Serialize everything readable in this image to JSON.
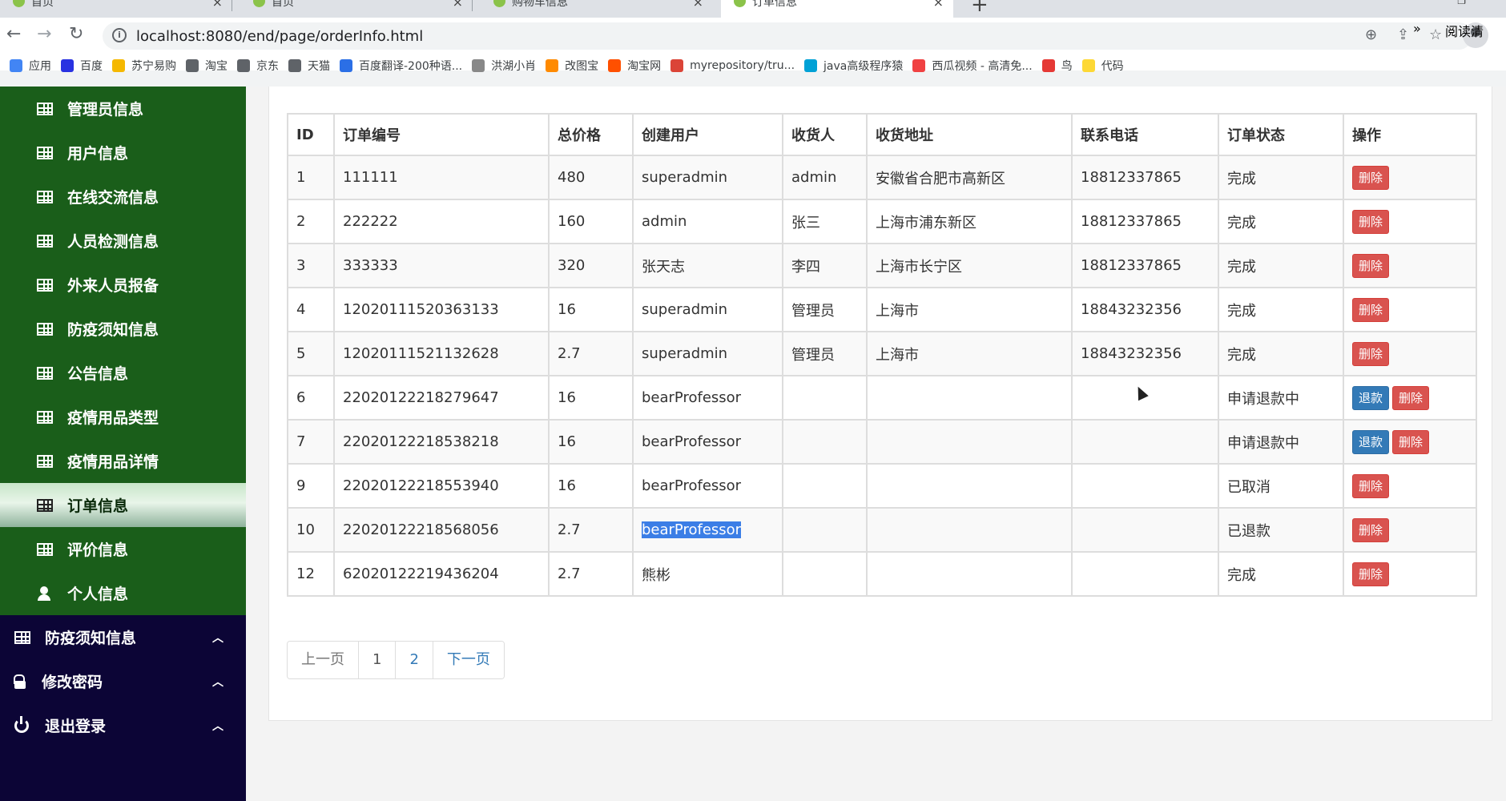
{
  "browser": {
    "tabs": [
      {
        "title": "首页"
      },
      {
        "title": "首页"
      },
      {
        "title": "购物车信息"
      },
      {
        "title": "订单信息"
      }
    ],
    "url": "localhost:8080/end/page/orderInfo.html",
    "bookmarks": [
      {
        "label": "应用",
        "color": "#4285f4"
      },
      {
        "label": "百度",
        "color": "#2932e1"
      },
      {
        "label": "苏宁易购",
        "color": "#f5b800"
      },
      {
        "label": "淘宝",
        "color": "#5f6368"
      },
      {
        "label": "京东",
        "color": "#5f6368"
      },
      {
        "label": "天猫",
        "color": "#5f6368"
      },
      {
        "label": "百度翻译-200种语...",
        "color": "#2b6fe6"
      },
      {
        "label": "洪湖小肖",
        "color": "#888888"
      },
      {
        "label": "改图宝",
        "color": "#ff8a00"
      },
      {
        "label": "淘宝网",
        "color": "#ff5000"
      },
      {
        "label": "myrepository/tru...",
        "color": "#db4437"
      },
      {
        "label": "java高级程序猿",
        "color": "#00a1d6"
      },
      {
        "label": "西瓜视频 - 高清免...",
        "color": "#f04142"
      },
      {
        "label": "鸟",
        "color": "#e53935"
      },
      {
        "label": "代码",
        "color": "#fdd835"
      }
    ],
    "bookmarks_more": "»",
    "reading_list": "阅读清"
  },
  "sidebar": {
    "sub_items": [
      {
        "label": "管理员信息"
      },
      {
        "label": "用户信息"
      },
      {
        "label": "在线交流信息"
      },
      {
        "label": "人员检测信息"
      },
      {
        "label": "外来人员报备"
      },
      {
        "label": "防疫须知信息"
      },
      {
        "label": "公告信息"
      },
      {
        "label": "疫情用品类型"
      },
      {
        "label": "疫情用品详情"
      },
      {
        "label": "订单信息"
      },
      {
        "label": "评价信息"
      },
      {
        "label": "个人信息"
      }
    ],
    "top_items": [
      {
        "label": "防疫须知信息"
      },
      {
        "label": "修改密码"
      },
      {
        "label": "退出登录"
      }
    ]
  },
  "table": {
    "headers": [
      "ID",
      "订单编号",
      "总价格",
      "创建用户",
      "收货人",
      "收货地址",
      "联系电话",
      "订单状态",
      "操作"
    ],
    "rows": [
      {
        "id": "1",
        "no": "111111",
        "price": "480",
        "user": "superadmin",
        "receiver": "admin",
        "address": "安徽省合肥市高新区",
        "phone": "18812337865",
        "status": "完成"
      },
      {
        "id": "2",
        "no": "222222",
        "price": "160",
        "user": "admin",
        "receiver": "张三",
        "address": "上海市浦东新区",
        "phone": "18812337865",
        "status": "完成"
      },
      {
        "id": "3",
        "no": "333333",
        "price": "320",
        "user": "张天志",
        "receiver": "李四",
        "address": "上海市长宁区",
        "phone": "18812337865",
        "status": "完成"
      },
      {
        "id": "4",
        "no": "12020111520363133",
        "price": "16",
        "user": "superadmin",
        "receiver": "管理员",
        "address": "上海市",
        "phone": "18843232356",
        "status": "完成"
      },
      {
        "id": "5",
        "no": "12020111521132628",
        "price": "2.7",
        "user": "superadmin",
        "receiver": "管理员",
        "address": "上海市",
        "phone": "18843232356",
        "status": "完成"
      },
      {
        "id": "6",
        "no": "22020122218279647",
        "price": "16",
        "user": "bearProfessor",
        "receiver": "",
        "address": "",
        "phone": "",
        "status": "申请退款中"
      },
      {
        "id": "7",
        "no": "22020122218538218",
        "price": "16",
        "user": "bearProfessor",
        "receiver": "",
        "address": "",
        "phone": "",
        "status": "申请退款中"
      },
      {
        "id": "9",
        "no": "22020122218553940",
        "price": "16",
        "user": "bearProfessor",
        "receiver": "",
        "address": "",
        "phone": "",
        "status": "已取消"
      },
      {
        "id": "10",
        "no": "22020122218568056",
        "price": "2.7",
        "user": "bearProfessor",
        "receiver": "",
        "address": "",
        "phone": "",
        "status": "已退款"
      },
      {
        "id": "12",
        "no": "62020122219436204",
        "price": "2.7",
        "user": "熊彬",
        "receiver": "",
        "address": "",
        "phone": "",
        "status": "完成"
      }
    ],
    "delete_label": "删除",
    "refund_label": "退款"
  },
  "pagination": {
    "prev": "上一页",
    "pages": [
      "1",
      "2"
    ],
    "next": "下一页"
  }
}
